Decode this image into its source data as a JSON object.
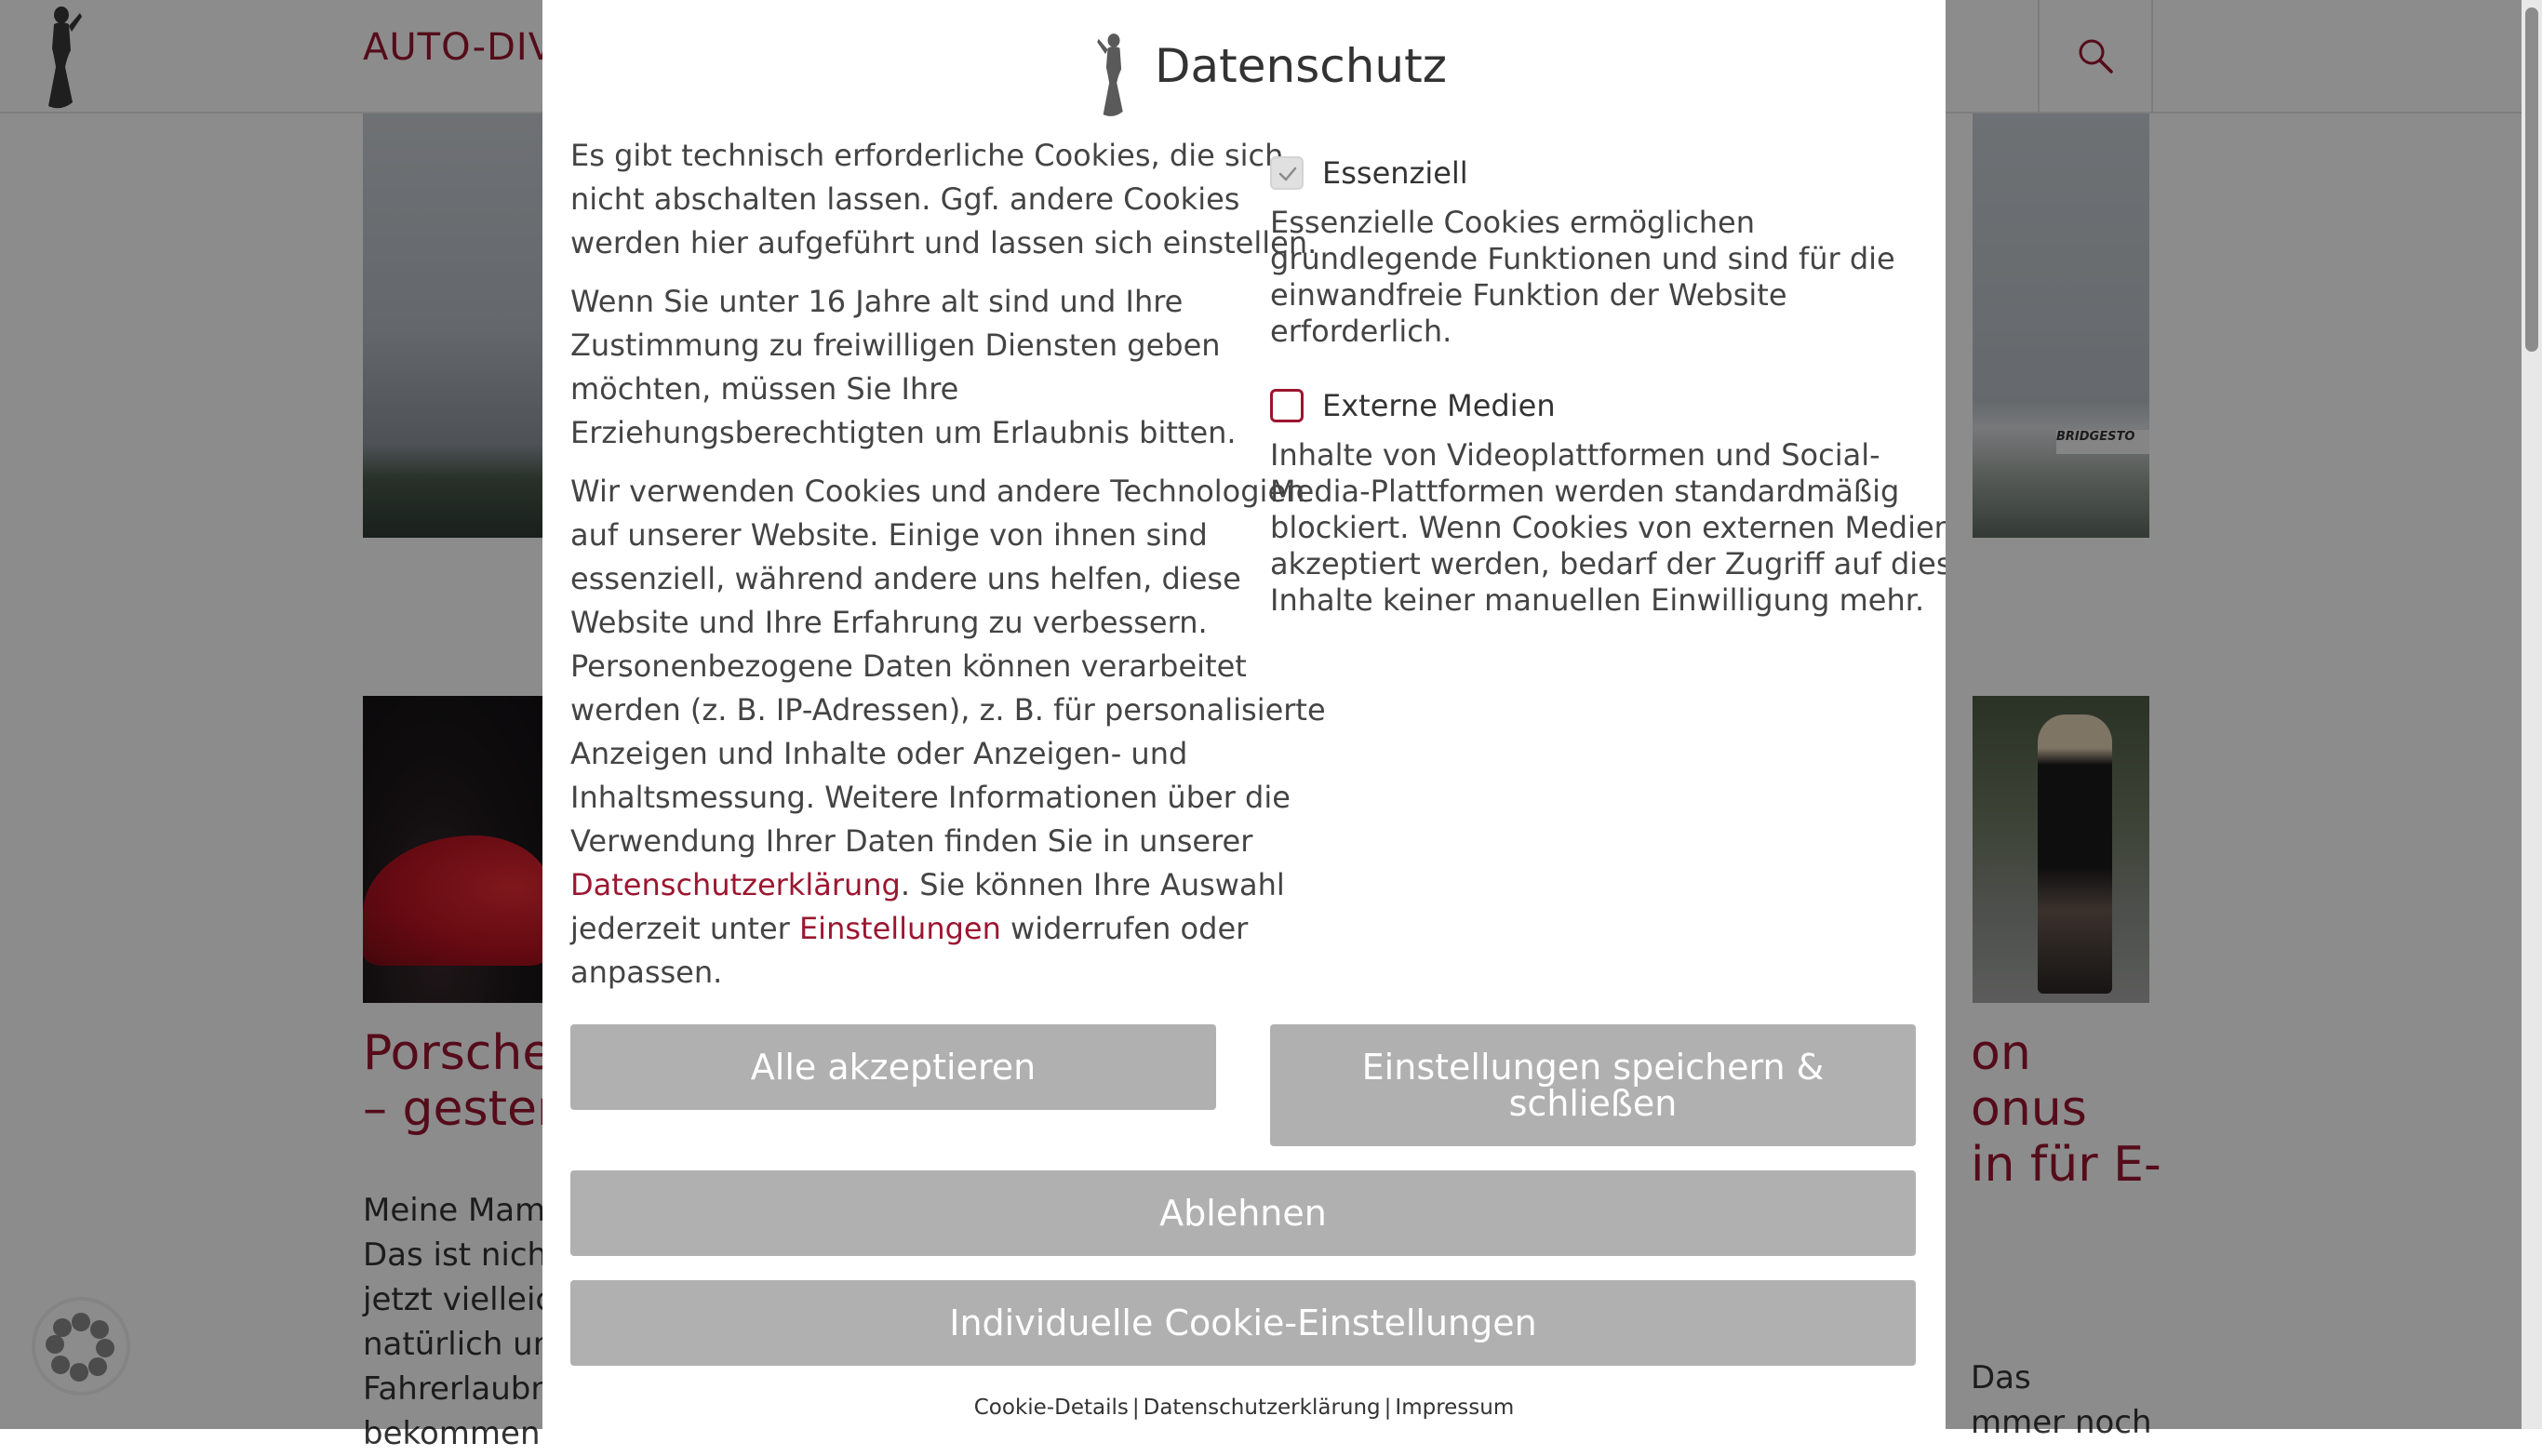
{
  "site": {
    "title": "AUTO-DIV",
    "card_left": {
      "title": "Porsche\n– gester",
      "text": "Meine Mam\nDas ist nicht\njetzt vielleich\nnatürlich um\nFahrerlaubn\nbekommen"
    },
    "card_right": {
      "title": "on\nonus\nin für E-",
      "text": "Das\nmmer noch"
    },
    "hero_sign": "BRIDGESTO"
  },
  "modal": {
    "title": "Datenschutz",
    "intro_1": "Es gibt technisch erforderliche Cookies, die sich\nnicht abschalten lassen. Ggf. andere Cookies\nwerden hier aufgeführt und lassen sich einstellen.",
    "intro_2": "Wenn Sie unter 16 Jahre alt sind und Ihre\nZustimmung zu freiwilligen Diensten geben\nmöchten, müssen Sie Ihre\nErziehungsberechtigten um Erlaubnis bitten.",
    "intro_3_part1": "Wir verwenden Cookies und andere Technologien\nauf unserer Website. Einige von ihnen sind\nessenziell, während andere uns helfen, diese\nWebsite und Ihre Erfahrung zu verbessern.\nPersonenbezogene Daten können verarbeitet\nwerden (z. B. IP-Adressen), z. B. für personalisierte\nAnzeigen und Inhalte oder Anzeigen- und\nInhaltsmessung. Weitere Informationen über die\nVerwendung Ihrer Daten finden Sie in unserer\n",
    "intro_3_link1": "Datenschutzerklärung",
    "intro_3_part2": ". Sie können Ihre Auswahl\njederzeit unter ",
    "intro_3_link2": "Einstellungen",
    "intro_3_part3": " widerrufen oder\nanpassen.",
    "categories": [
      {
        "label": "Essenziell",
        "checked": true,
        "description": "Essenzielle Cookies ermöglichen\ngrundlegende Funktionen und sind für die\neinwandfreie Funktion der Website\nerforderlich."
      },
      {
        "label": "Externe Medien",
        "checked": false,
        "description": "Inhalte von Videoplattformen und Social-\nMedia-Plattformen werden standardmäßig\nblockiert. Wenn Cookies von externen Medien\nakzeptiert werden, bedarf der Zugriff auf diese\nInhalte keiner manuellen Einwilligung mehr."
      }
    ],
    "buttons": {
      "accept_all": "Alle akzeptieren",
      "save_close": "Einstellungen speichern &\nschließen",
      "decline": "Ablehnen",
      "individual": "Individuelle Cookie-Einstellungen"
    },
    "footer": {
      "cookie_details": "Cookie-Details",
      "privacy": "Datenschutzerklärung",
      "imprint": "Impressum",
      "separator": "|"
    }
  },
  "colors": {
    "accent": "#9b1630",
    "button_bg": "#b0b0b0",
    "overlay": "rgba(0,0,0,0.45)"
  },
  "icons": [
    "lady-logo-icon",
    "search-icon",
    "checkmark-icon",
    "chat-bubble-icon"
  ]
}
